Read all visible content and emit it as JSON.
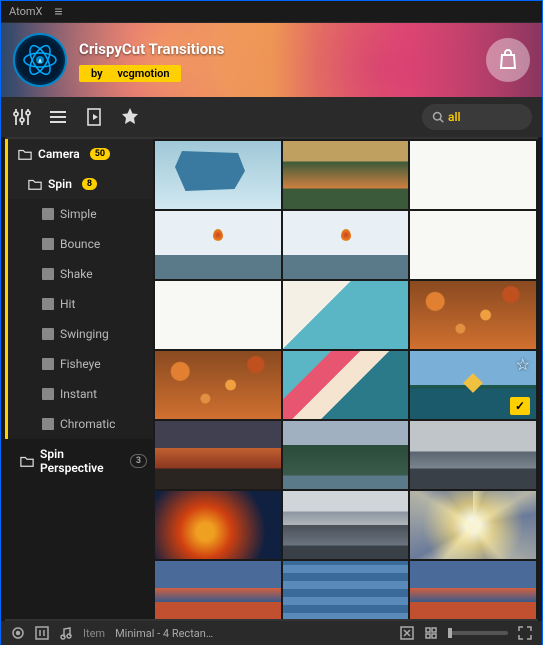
{
  "titlebar": {
    "app_name": "AtomX"
  },
  "header": {
    "title": "CrispyCut Transitions",
    "author_prefix": "by ",
    "author": "vcgmotion"
  },
  "search": {
    "value": "all"
  },
  "sidebar": {
    "camera": {
      "label": "Camera",
      "count": "50"
    },
    "spin": {
      "label": "Spin",
      "count": "8"
    },
    "leaves": [
      {
        "label": "Simple"
      },
      {
        "label": "Bounce"
      },
      {
        "label": "Shake"
      },
      {
        "label": "Hit"
      },
      {
        "label": "Swinging"
      },
      {
        "label": "Fisheye"
      },
      {
        "label": "Instant"
      },
      {
        "label": "Chromatic"
      }
    ],
    "spin_perspective": {
      "label": "Spin Perspective",
      "count": "3"
    }
  },
  "footer": {
    "item_label": "Item",
    "item_value": "Minimal - 4 Rectan…"
  }
}
